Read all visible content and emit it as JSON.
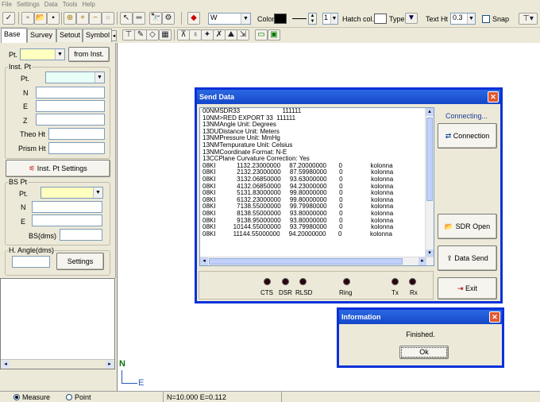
{
  "menu": [
    "File",
    "Settings",
    "Data",
    "Tools",
    "Help"
  ],
  "toolbar": {
    "layer_value": "W",
    "color_label": "Color",
    "color_swatch": "#000000",
    "line_width_value": "1",
    "hatch_col_label": "Hatch col.",
    "type_label": "Type",
    "text_ht_label": "Text Ht",
    "text_ht_value": "0.3",
    "snap_label": "Snap"
  },
  "tabs": [
    "Base",
    "Survey",
    "Setout",
    "Symbol"
  ],
  "left_panel": {
    "pt_label": "Pt.",
    "from_inst_button": "from Inst.",
    "inst_pt_group": "Inst. Pt",
    "inst_pt_label": "Pt.",
    "n_label": "N",
    "e_label": "E",
    "z_label": "Z",
    "theo_ht_label": "Theo Ht",
    "prism_ht_label": "Prism Ht",
    "inst_pt_settings_button": "Inst. Pt Settings",
    "bs_pt_group": "BS Pt",
    "bs_pt_label": "Pt.",
    "bs_n_label": "N",
    "bs_e_label": "E",
    "bs_dms_label": "BS(dms)",
    "h_angle_group": "H. Angle(dms)",
    "settings_button": "Settings"
  },
  "axis": {
    "n": "N",
    "e": "E"
  },
  "statusbar": {
    "measure_label": "Measure",
    "point_label": "Point",
    "coords": "N=10.000  E=0.112"
  },
  "send_data": {
    "title": "Send Data",
    "status": "Connecting...",
    "connection_button": "Connection",
    "sdr_open_button": "SDR Open File",
    "data_send_button": "Data Send",
    "exit_button": "Exit",
    "log_lines": [
      "00NMSDR33                        111111",
      "10NM>RED EXPORT 33  111111",
      "13NMAngle Unit: Degrees",
      "13DUDistance Unit: Meters",
      "13NMPressure Unit: MmHg",
      "13NMTempurature Unit: Celsius",
      "13NMCoordinate Format: N-E",
      "13CCPlane Curvature Correction: Yes",
      "08KI            1132.23000000     87.20000000       0                kolonna",
      "08KI            2132.23000000     87.59980000       0                kolonna",
      "08KI            3132.06850000     93.63000000       0                kolonna",
      "08KI            4132.06850000     94.23000000       0                kolonna",
      "08KI            5131.83000000     99.80000000       0                kolonna",
      "08KI            6132.23000000     99.80000000       0                kolonna",
      "08KI            7138.55000000     99.79980000       0                kolonna",
      "08KI            8138.55000000     93.80000000       0                kolonna",
      "08KI            9138.95000000     93.80000000       0                kolonna",
      "08KI          10144.55000000     93.79980000       0                kolonna",
      "08KI          11144.55000000     94.20000000       0                kolonna"
    ],
    "leds": [
      "CTS",
      "DSR",
      "RLSD",
      "Ring",
      "Tx",
      "Rx"
    ]
  },
  "info_dialog": {
    "title": "Information",
    "message": "Finished.",
    "ok_button": "Ok"
  }
}
